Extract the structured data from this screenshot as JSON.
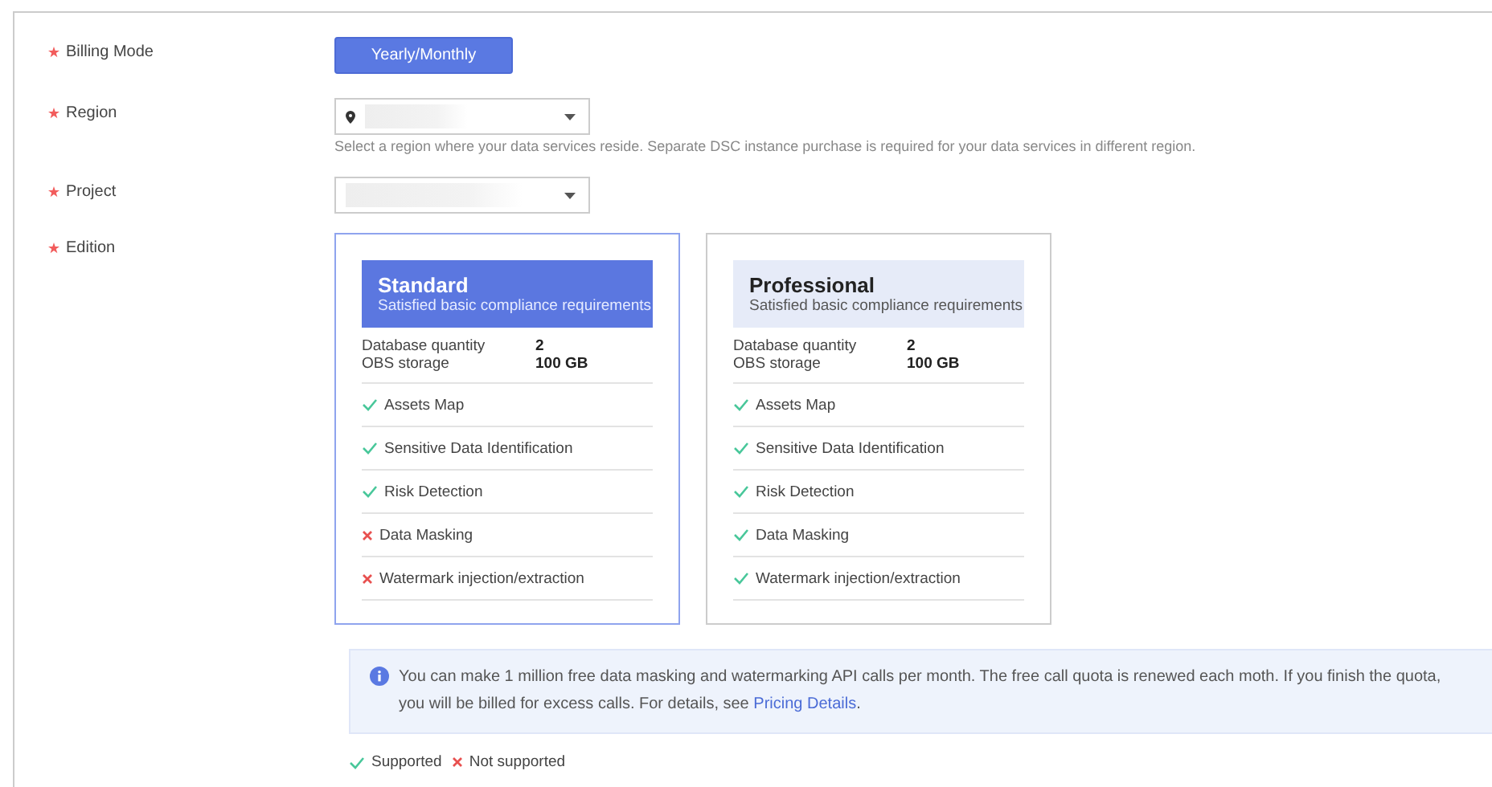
{
  "billing_mode": {
    "label": "Billing Mode",
    "required": true,
    "button": "Yearly/Monthly"
  },
  "region": {
    "label": "Region",
    "required": true,
    "hint": "Select a region where your data services reside. Separate DSC instance purchase is required for your data services in different region."
  },
  "project": {
    "label": "Project",
    "required": true
  },
  "edition": {
    "label": "Edition",
    "required": true,
    "cards": [
      {
        "name": "Standard",
        "subtitle": "Satisfied basic compliance requirements",
        "selected": true,
        "specs": [
          {
            "label": "Database quantity",
            "value": "2"
          },
          {
            "label": "OBS storage",
            "value": "100 GB"
          }
        ],
        "features": [
          {
            "label": "Assets Map",
            "supported": true
          },
          {
            "label": "Sensitive Data Identification",
            "supported": true
          },
          {
            "label": "Risk Detection",
            "supported": true
          },
          {
            "label": "Data Masking",
            "supported": false
          },
          {
            "label": "Watermark injection/extraction",
            "supported": false
          }
        ]
      },
      {
        "name": "Professional",
        "subtitle": "Satisfied basic compliance requirements",
        "selected": false,
        "specs": [
          {
            "label": "Database quantity",
            "value": "2"
          },
          {
            "label": "OBS storage",
            "value": "100 GB"
          }
        ],
        "features": [
          {
            "label": "Assets Map",
            "supported": true
          },
          {
            "label": "Sensitive Data Identification",
            "supported": true
          },
          {
            "label": "Risk Detection",
            "supported": true
          },
          {
            "label": "Data Masking",
            "supported": true
          },
          {
            "label": "Watermark injection/extraction",
            "supported": true
          }
        ]
      }
    ]
  },
  "info": {
    "text": "You can make 1 million free data masking and watermarking API calls per month. The free call quota is renewed each moth. If you finish the quota, you will be billed for excess calls. For details, see ",
    "link": "Pricing Details",
    "tail": "."
  },
  "legend": [
    {
      "label": "Supported",
      "supported": true
    },
    {
      "label": "Not supported",
      "supported": false
    }
  ]
}
